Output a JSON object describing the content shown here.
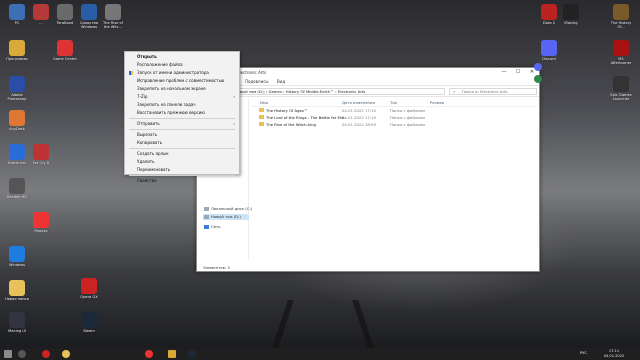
{
  "context_menu": {
    "items": [
      {
        "label": "Открыть",
        "bold": true
      },
      {
        "label": "Расположение файла"
      },
      {
        "label": "Запуск от имени администратора",
        "shield": true
      },
      {
        "label": "Исправление проблем с совместимостью"
      },
      {
        "label": "Закрепить на начальном экране"
      },
      {
        "label": "7-Zip",
        "submenu": true
      },
      {
        "label": "Закрепить на панели задач"
      },
      {
        "label": "Восстановить прежнюю версию"
      },
      {
        "sep": true
      },
      {
        "label": "Отправить",
        "submenu": true
      },
      {
        "sep": true
      },
      {
        "label": "Вырезать"
      },
      {
        "label": "Копировать"
      },
      {
        "sep": true
      },
      {
        "label": "Создать ярлык"
      },
      {
        "label": "Удалить"
      },
      {
        "label": "Переименовать"
      },
      {
        "sep": true
      },
      {
        "label": "Свойства"
      }
    ]
  },
  "explorer": {
    "title": "Electronic Arts",
    "ribbon_tabs": [
      "Подевлисы",
      "Вид"
    ],
    "address": "› Новый том (D:) › Games › History Of Middle-Earth™ › Electronic Arts",
    "search_placeholder": "Поиск в: Electronic Arts",
    "columns": {
      "name": "Имя",
      "date": "Дата изменения",
      "type": "Тип",
      "size": "Размер"
    },
    "rows": [
      {
        "name": "The History Of Ages™",
        "date": "04.01.2022 17:10",
        "type": "Папка с файлами"
      },
      {
        "name": "The Lord of the Rings - The Battle for Mid...",
        "date": "04.01.2022 17:10",
        "type": "Папка с файлами"
      },
      {
        "name": "The Rise of the Witch-king",
        "date": "04.01.2022 18:59",
        "type": "Папка с файлами"
      }
    ],
    "nav": {
      "disk_c": "Локальный диск (C:)",
      "disk_d": "Новый том (D:)",
      "network": "Сеть"
    },
    "status": "Элементов: 3"
  },
  "desktop_icons": [
    {
      "label": "PC",
      "color": "#3d6fb5"
    },
    {
      "label": "...",
      "color": "#b43a3a"
    },
    {
      "label": "TeraBand",
      "color": "#6a6a6a"
    },
    {
      "label": "Средства Windows",
      "color": "#2a5ca8"
    },
    {
      "label": "The Rise of the Witc...",
      "color": "#777"
    },
    {
      "label": "Dota 2",
      "color": "#b22"
    },
    {
      "label": "iRacing",
      "color": "#222"
    },
    {
      "label": "The History Of...",
      "color": "#7a5a2b"
    },
    {
      "label": "Программы",
      "color": "#d9a93a"
    },
    {
      "label": "Game Center",
      "color": "#d33"
    },
    {
      "label": "Discord",
      "color": "#5865f2"
    },
    {
      "label": "MS Afterburner",
      "color": "#a11"
    },
    {
      "label": "Adobe Photoshop",
      "color": "#2a4ea8"
    },
    {
      "label": "Epic Games Launcher",
      "color": "#333"
    },
    {
      "label": "AnyDesk",
      "color": "#d73"
    },
    {
      "label": "Battle.net",
      "color": "#2a6dd9"
    },
    {
      "label": "Far Cry 6",
      "color": "#b33"
    },
    {
      "label": "Realtek HD",
      "color": "#555"
    },
    {
      "label": "Яндекс",
      "color": "#e33"
    },
    {
      "label": "Windows",
      "color": "#1e7be0"
    },
    {
      "label": "Новая папка",
      "color": "#e8c15a"
    },
    {
      "label": "iRacing UI",
      "color": "#334"
    },
    {
      "label": "Opera GX",
      "color": "#c22"
    },
    {
      "label": "Steam",
      "color": "#1b2838"
    }
  ],
  "taskbar": {
    "lang": "РУС",
    "time": "17:11",
    "date": "04.01.2022"
  }
}
